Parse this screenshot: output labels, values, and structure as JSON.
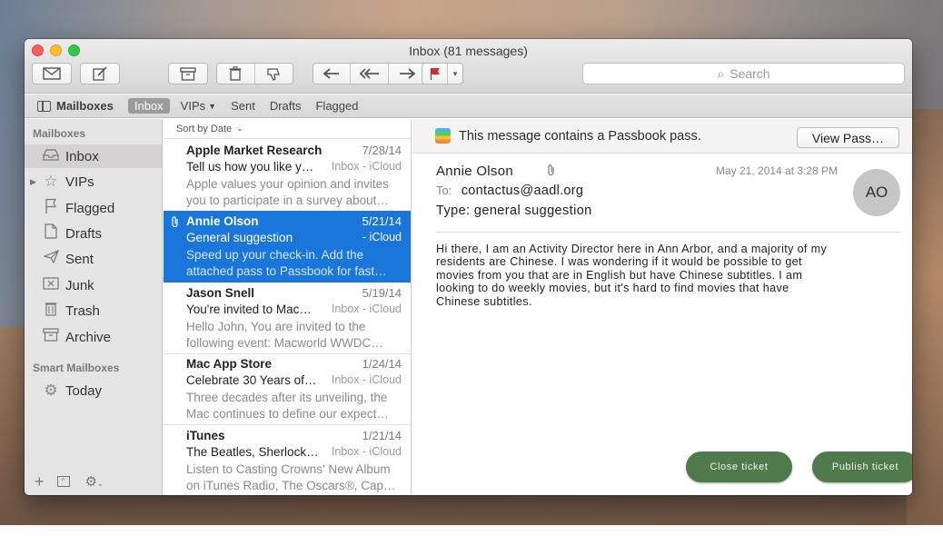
{
  "window": {
    "title": "Inbox (81 messages)"
  },
  "toolbar": {
    "compose_icon": "envelope-icon",
    "new_message_icon": "compose-icon",
    "search_placeholder": "Search"
  },
  "favorites": {
    "mailboxes": "Mailboxes",
    "inbox": "Inbox",
    "vips": "VIPs",
    "sent": "Sent",
    "drafts": "Drafts",
    "flagged": "Flagged"
  },
  "sidebar": {
    "header": "Mailboxes",
    "items": [
      {
        "label": "Inbox",
        "icon": "inbox-icon"
      },
      {
        "label": "VIPs",
        "icon": "star-icon"
      },
      {
        "label": "Flagged",
        "icon": "flag-icon"
      },
      {
        "label": "Drafts",
        "icon": "document-icon"
      },
      {
        "label": "Sent",
        "icon": "paper-plane-icon"
      },
      {
        "label": "Junk",
        "icon": "junk-icon"
      },
      {
        "label": "Trash",
        "icon": "trash-icon"
      },
      {
        "label": "Archive",
        "icon": "archive-icon"
      }
    ],
    "smart_header": "Smart Mailboxes",
    "smart_items": [
      {
        "label": "Today",
        "icon": "gear-icon"
      }
    ]
  },
  "list": {
    "sort_label": "Sort by Date",
    "messages": [
      {
        "sender": "Apple Market Research",
        "date": "7/28/14",
        "subject": "Tell us how you like y…",
        "mailbox": "Inbox - iCloud",
        "preview1": "Apple values your opinion and invites",
        "preview2": "you to participate in a survey about…"
      },
      {
        "sender": "Annie Olson",
        "date": "5/21/14",
        "subject": "General suggestion",
        "mailbox": "- iCloud",
        "preview1": "Speed up your check-in. Add the",
        "preview2": "attached pass to Passbook for fast…"
      },
      {
        "sender": "Jason Snell",
        "date": "5/19/14",
        "subject": "You're invited to Mac…",
        "mailbox": "Inbox - iCloud",
        "preview1": "Hello John, You are invited to the",
        "preview2": "following event: Macworld WWDC…"
      },
      {
        "sender": "Mac App Store",
        "date": "1/24/14",
        "subject": "Celebrate 30 Years of…",
        "mailbox": "Inbox - iCloud",
        "preview1": "Three decades after its unveiling, the",
        "preview2": "Mac continues to define our expect…"
      },
      {
        "sender": "iTunes",
        "date": "1/21/14",
        "subject": "The Beatles, Sherlock…",
        "mailbox": "Inbox - iCloud",
        "preview1": "Listen to Casting Crowns' New Album",
        "preview2": "on iTunes Radio, The Oscars®, Cap…"
      }
    ]
  },
  "reader": {
    "pass_notice": "This message contains a Passbook pass.",
    "view_pass": "View Pass…",
    "from": "Annie Olson",
    "date": "May 21, 2014 at 3:28 PM",
    "avatar": "AO",
    "to_label": "To:",
    "to": "contactus@aadl.org",
    "type": "Type: general suggestion",
    "body": [
      "Hi there, I am an Activity Director here in Ann Arbor, and a majority of my",
      "residents are Chinese. I was wondering if it would be possible to get",
      "movies from you that are in English but have Chinese subtitles. I am",
      "looking to do weekly movies, but it's hard to find movies that have",
      "Chinese subtitles."
    ],
    "close_ticket": "Close ticket",
    "publish_ticket": "Publish ticket"
  },
  "colors": {
    "selection": "#1a76da",
    "action_button": "#4f7a4c",
    "flag": "#e0262e"
  }
}
